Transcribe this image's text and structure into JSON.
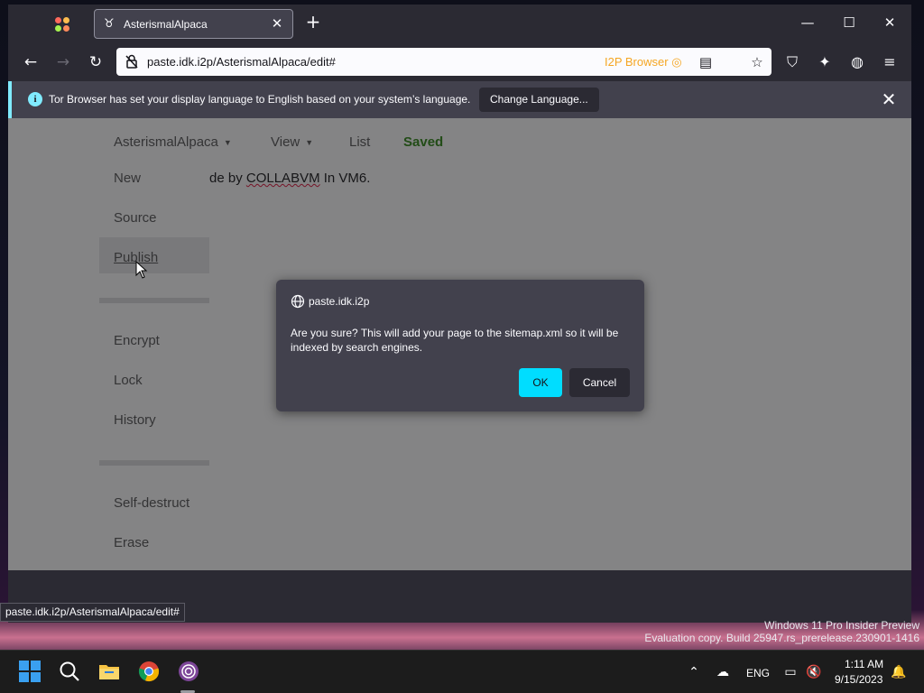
{
  "browser": {
    "tab": {
      "title": "AsterismalAlpaca"
    },
    "url": "paste.idk.i2p/AsterismalAlpaca/edit#",
    "i2p_badge": "I2P Browser"
  },
  "notification": {
    "text": "Tor Browser has set your display language to English based on your system’s language.",
    "button": "Change Language..."
  },
  "page": {
    "top_menu": {
      "site_name": "AsterismalAlpaca",
      "view": "View",
      "list": "List",
      "status": "Saved"
    },
    "side_menu": {
      "new": "New",
      "source": "Source",
      "publish": "Publish",
      "encrypt": "Encrypt",
      "lock": "Lock",
      "history": "History",
      "self_destruct": "Self-destruct",
      "erase": "Erase"
    },
    "paste_text": {
      "before": "de by ",
      "misspelled": "COLLABVM",
      "after": " In VM6."
    }
  },
  "dialog": {
    "origin": "paste.idk.i2p",
    "message": "Are you sure? This will add your page to the sitemap.xml so it will be indexed by search engines.",
    "ok": "OK",
    "cancel": "Cancel"
  },
  "status_bar": {
    "url": "paste.idk.i2p/AsterismalAlpaca/edit#"
  },
  "watermark": {
    "line1": "Windows 11 Pro Insider Preview",
    "line2": "Evaluation copy. Build 25947.rs_prerelease.230901-1416"
  },
  "taskbar": {
    "language": "ENG",
    "time": "1:11 AM",
    "date": "9/15/2023"
  }
}
